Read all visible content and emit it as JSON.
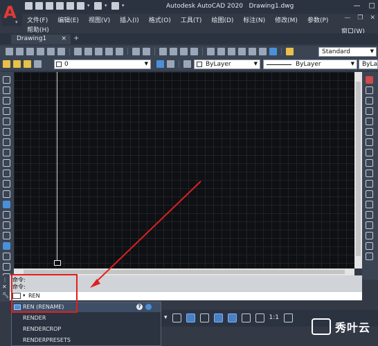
{
  "app": {
    "title": "Autodesk AutoCAD 2020",
    "filename": "Drawing1.dwg"
  },
  "menu": [
    "文件(F)",
    "编辑(E)",
    "视图(V)",
    "插入(I)",
    "格式(O)",
    "工具(T)",
    "绘图(D)",
    "标注(N)",
    "修改(M)",
    "参数(P)",
    "窗口(W)"
  ],
  "menu_extra": [
    "帮助(H)"
  ],
  "tab": {
    "label": "Drawing1",
    "close": "×",
    "add": "+"
  },
  "toolbar": {
    "text_style": "Standard",
    "layer": "0",
    "color": "ByLayer",
    "linetype": "ByLayer",
    "lineweight": "ByLa"
  },
  "command": {
    "history": [
      "命令:",
      "命令:"
    ],
    "input": "REN"
  },
  "autocomplete": {
    "items": [
      "REN (RENAME)",
      "RENDER",
      "RENDERCROP",
      "RENDERPRESETS"
    ],
    "selected_index": 0
  },
  "status": {
    "scale": "1:1"
  },
  "watermark": {
    "text": "秀叶云"
  },
  "colors": {
    "accent_red": "#e02020",
    "canvas_bg": "#0f1013"
  }
}
